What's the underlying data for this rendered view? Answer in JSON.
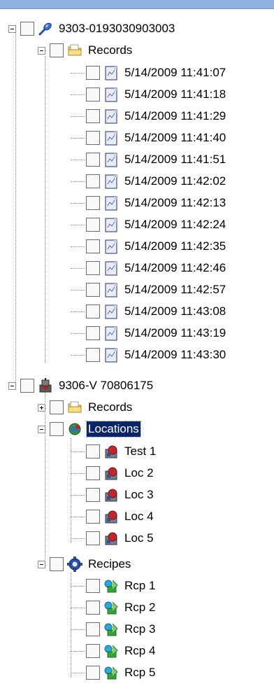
{
  "tree": {
    "device1": {
      "label": "9303-0193030903003",
      "icon": "microphone-device-icon",
      "records": {
        "label": "Records",
        "icon": "folder-icon",
        "items": [
          "5/14/2009 11:41:07",
          "5/14/2009 11:41:18",
          "5/14/2009 11:41:29",
          "5/14/2009 11:41:40",
          "5/14/2009 11:41:51",
          "5/14/2009 11:42:02",
          "5/14/2009 11:42:13",
          "5/14/2009 11:42:24",
          "5/14/2009 11:42:35",
          "5/14/2009 11:42:46",
          "5/14/2009 11:42:57",
          "5/14/2009 11:43:08",
          "5/14/2009 11:43:19",
          "5/14/2009 11:43:30"
        ],
        "item_icon": "record-document-icon"
      }
    },
    "device2": {
      "label": "9306-V 70806175",
      "icon": "meter-device-icon",
      "records": {
        "label": "Records",
        "icon": "folder-icon",
        "expanded": false
      },
      "locations": {
        "label": "Locations",
        "icon": "globe-icon",
        "selected": true,
        "items": [
          "Test 1",
          "Loc 2",
          "Loc 3",
          "Loc 4",
          "Loc 5"
        ],
        "item_icon": "location-icon"
      },
      "recipes": {
        "label": "Recipes",
        "icon": "gear-icon",
        "items": [
          "Rcp  1",
          "Rcp  2",
          "Rcp  3",
          "Rcp  4",
          "Rcp  5"
        ],
        "item_icon": "recipe-icon"
      }
    }
  },
  "colors": {
    "selection_bg": "#0a246a",
    "selection_fg": "#ffffff",
    "header_bar": "#8eb3e0"
  }
}
